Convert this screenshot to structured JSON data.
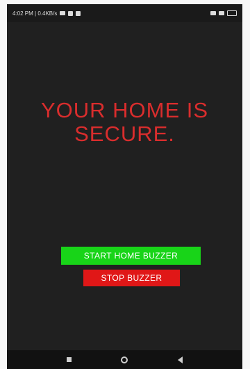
{
  "status_bar": {
    "time_and_speed": "4:02 PM | 0.4KB/s",
    "icons_left": [
      "video-icon",
      "notification-icon",
      "message-icon"
    ],
    "icons_right": [
      "sim-icon",
      "signal-icon",
      "battery-icon"
    ]
  },
  "main": {
    "title_line1": "YOUR HOME IS",
    "title_line2": "SECURE.",
    "start_button_label": "START HOME  BUZZER",
    "stop_button_label": "STOP BUZZER"
  },
  "colors": {
    "background": "#202020",
    "title": "#d92d2d",
    "start_button": "#18d418",
    "stop_button": "#e01717"
  },
  "nav_bar": {
    "buttons": [
      "recent-apps-icon",
      "home-icon",
      "back-icon"
    ]
  }
}
